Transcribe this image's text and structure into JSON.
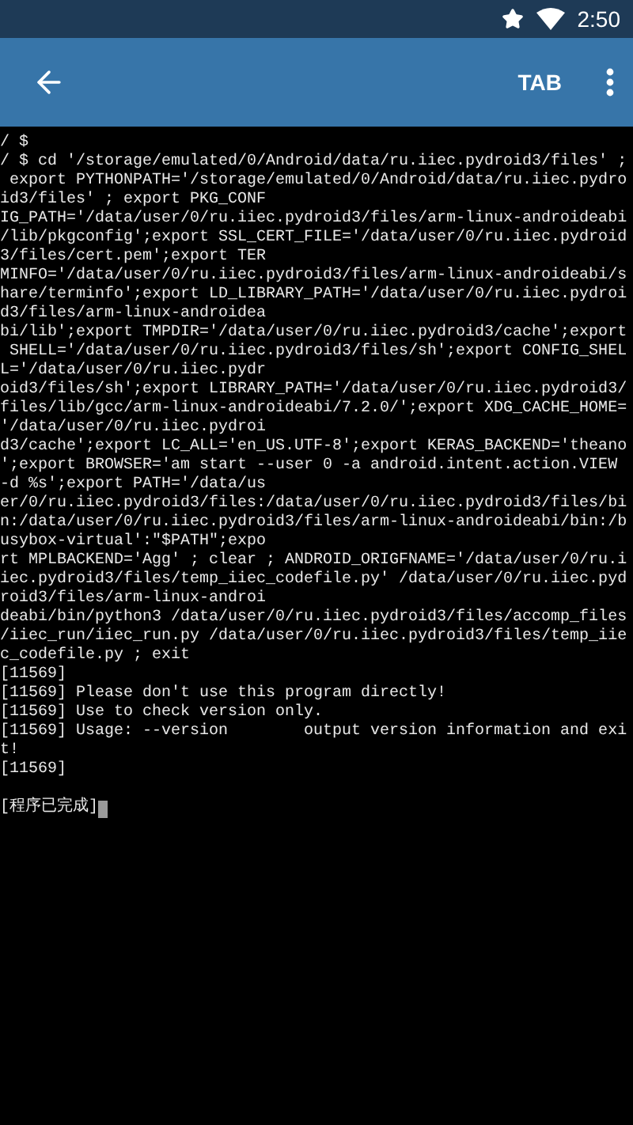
{
  "status_bar": {
    "time": "2:50"
  },
  "toolbar": {
    "tab_label": "TAB"
  },
  "terminal": {
    "lines": [
      {
        "kind": "output",
        "text": "/ $"
      },
      {
        "kind": "output",
        "text": "/ $ cd '/storage/emulated/0/Android/data/ru.iiec.pydroid3/files' ;"
      },
      {
        "kind": "output",
        "text": " export PYTHONPATH='/storage/emulated/0/Android/data/ru.iiec.pydro"
      },
      {
        "kind": "output",
        "text": "id3/files' ; export PKG_CONF"
      },
      {
        "kind": "output",
        "text": "IG_PATH='/data/user/0/ru.iiec.pydroid3/files/arm-linux-androideabi"
      },
      {
        "kind": "output",
        "text": "/lib/pkgconfig';export SSL_CERT_FILE='/data/user/0/ru.iiec.pydroid"
      },
      {
        "kind": "output",
        "text": "3/files/cert.pem';export TER"
      },
      {
        "kind": "output",
        "text": "MINFO='/data/user/0/ru.iiec.pydroid3/files/arm-linux-androideabi/s"
      },
      {
        "kind": "output",
        "text": "hare/terminfo';export LD_LIBRARY_PATH='/data/user/0/ru.iiec.pydroi"
      },
      {
        "kind": "output",
        "text": "d3/files/arm-linux-androidea"
      },
      {
        "kind": "output",
        "text": "bi/lib';export TMPDIR='/data/user/0/ru.iiec.pydroid3/cache';export"
      },
      {
        "kind": "output",
        "text": " SHELL='/data/user/0/ru.iiec.pydroid3/files/sh';export CONFIG_SHEL"
      },
      {
        "kind": "output",
        "text": "L='/data/user/0/ru.iiec.pydr"
      },
      {
        "kind": "output",
        "text": "oid3/files/sh';export LIBRARY_PATH='/data/user/0/ru.iiec.pydroid3/"
      },
      {
        "kind": "output",
        "text": "files/lib/gcc/arm-linux-androideabi/7.2.0/';export XDG_CACHE_HOME="
      },
      {
        "kind": "output",
        "text": "'/data/user/0/ru.iiec.pydroi"
      },
      {
        "kind": "output",
        "text": "d3/cache';export LC_ALL='en_US.UTF-8';export KERAS_BACKEND='theano"
      },
      {
        "kind": "output",
        "text": "';export BROWSER='am start --user 0 -a android.intent.action.VIEW"
      },
      {
        "kind": "output",
        "text": "-d %s';export PATH='/data/us"
      },
      {
        "kind": "output",
        "text": "er/0/ru.iiec.pydroid3/files:/data/user/0/ru.iiec.pydroid3/files/bi"
      },
      {
        "kind": "output",
        "text": "n:/data/user/0/ru.iiec.pydroid3/files/arm-linux-androideabi/bin:/b"
      },
      {
        "kind": "output",
        "text": "usybox-virtual':\"$PATH\";expo"
      },
      {
        "kind": "output",
        "text": "rt MPLBACKEND='Agg' ; clear ; ANDROID_ORIGFNAME='/data/user/0/ru.i"
      },
      {
        "kind": "output",
        "text": "iec.pydroid3/files/temp_iiec_codefile.py' /data/user/0/ru.iiec.pyd"
      },
      {
        "kind": "output",
        "text": "roid3/files/arm-linux-androi"
      },
      {
        "kind": "output",
        "text": "deabi/bin/python3 /data/user/0/ru.iiec.pydroid3/files/accomp_files"
      },
      {
        "kind": "output",
        "text": "/iiec_run/iiec_run.py /data/user/0/ru.iiec.pydroid3/files/temp_iie"
      },
      {
        "kind": "output",
        "text": "c_codefile.py ; exit"
      },
      {
        "kind": "output",
        "text": "[11569]"
      },
      {
        "kind": "output",
        "text": "[11569] Please don't use this program directly!"
      },
      {
        "kind": "output",
        "text": "[11569] Use to check version only."
      },
      {
        "kind": "output",
        "text": "[11569] Usage: --version        output version information and exi"
      },
      {
        "kind": "output",
        "text": "t!"
      },
      {
        "kind": "output",
        "text": "[11569]"
      },
      {
        "kind": "finished",
        "text": "[程序已完成]"
      }
    ]
  }
}
